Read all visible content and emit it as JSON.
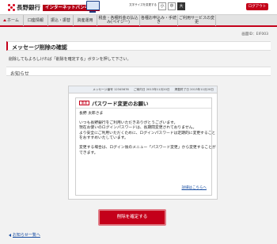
{
  "header": {
    "bank_name": "長野銀行",
    "service_badge": "インターネットバンキング",
    "textsize_label": "文字サイズを変更する",
    "font_sizes": [
      "小",
      "中",
      "大"
    ],
    "logout_label": "ログアウト"
  },
  "nav": {
    "items": [
      {
        "label": "ホーム"
      },
      {
        "label": "口座情報"
      },
      {
        "label": "振込・振替"
      },
      {
        "label": "資産運用"
      },
      {
        "label": "税金・各種料金の払込み(ペイジー)"
      },
      {
        "label": "各種お申込み・手続き"
      },
      {
        "label": "ご利用サービスの変更"
      }
    ]
  },
  "page": {
    "id": "画面ID：EIF003",
    "title": "メッセージ削除の確認",
    "instruction": "削除してもよろしければ「削除を確定する」ボタンを押して下さい。",
    "section_title": "お知らせ"
  },
  "notice": {
    "message_no": "メッセージ番号 12345676",
    "posted": "ご案内日 2013年11月20日",
    "expiry": "掲載終了日 2013年11月20日",
    "tag": "重要",
    "title": "パスワード変更のお願い",
    "lines": [
      "長野 太郎さま",
      "いつも長野銀行をご利用いただきありがとうございます。",
      "現在お使いのログインパスワードは、長期間変更されておりません。",
      "より安全にご利用いただくために、ログインパスワードは定期的に変更すること",
      "をおすすめいたしています。",
      "変更する場合は、ログイン後のメニュー「パスワード変更」から変更することが",
      "できます。"
    ],
    "detail_link": "詳細はこちらへ"
  },
  "actions": {
    "confirm_label": "削除を確定する",
    "back_label": "お知らせ一覧へ"
  },
  "colors": {
    "brand_red": "#c4001a",
    "link_blue": "#1a4fa3"
  }
}
